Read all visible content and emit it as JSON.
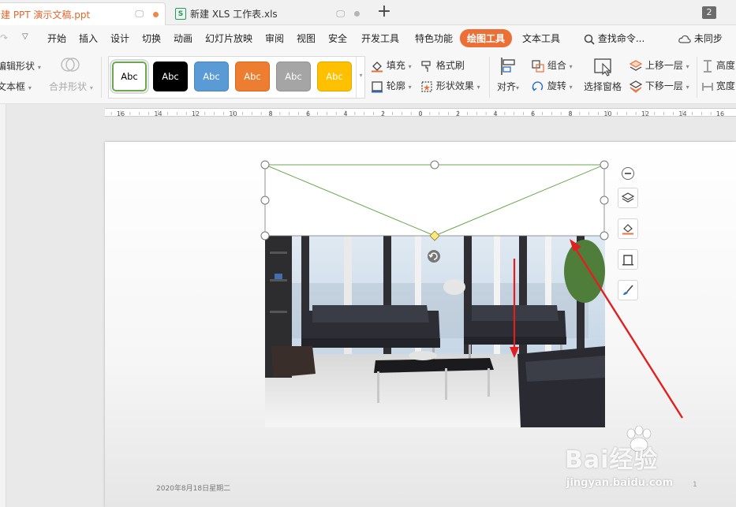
{
  "tabs": [
    {
      "label": "新建 PPT 演示文稿.ppt",
      "active": true
    },
    {
      "label": "新建 XLS 工作表.xls",
      "active": false,
      "icon": "S"
    }
  ],
  "window_count": "2",
  "menu": {
    "items": [
      "开始",
      "插入",
      "设计",
      "切换",
      "动画",
      "幻灯片放映",
      "审阅",
      "视图",
      "安全",
      "开发工具",
      "特色功能",
      "绘图工具",
      "文本工具"
    ],
    "active": "绘图工具",
    "search_label": "查找命令...",
    "sync_label": "未同步"
  },
  "toolbar": {
    "edit_shape": "编辑形状",
    "text_box": "文本框",
    "merge_shape": "合并形状",
    "style_sample": "Abc",
    "style_colors": [
      "#ffffff",
      "#000000",
      "#5b9bd5",
      "#ed7d31",
      "#a5a5a5",
      "#ffc000"
    ],
    "fill": "填充",
    "outline": "轮廓",
    "format_painter": "格式刷",
    "shape_effects": "形状效果",
    "align": "对齐",
    "group": "组合",
    "rotate": "旋转",
    "selection_pane": "选择窗格",
    "bring_forward": "上移一层",
    "send_backward": "下移一层",
    "height": "高度",
    "width": "宽度"
  },
  "ruler_labels": [
    "16",
    "14",
    "12",
    "10",
    "8",
    "6",
    "4",
    "2",
    "0",
    "2",
    "4",
    "6",
    "8",
    "10",
    "12",
    "14",
    "16"
  ],
  "slide": {
    "footer_date": "2020年8月18日星期二",
    "footer_page": "1"
  },
  "colors": {
    "accent": "#ec6f36",
    "shape_line": "#6aa84f",
    "handle_yellow": "#ffe680",
    "arrow_red": "#e02020"
  },
  "watermark": {
    "brand": "Bai经验",
    "url": "jingyan.baidu.com"
  }
}
